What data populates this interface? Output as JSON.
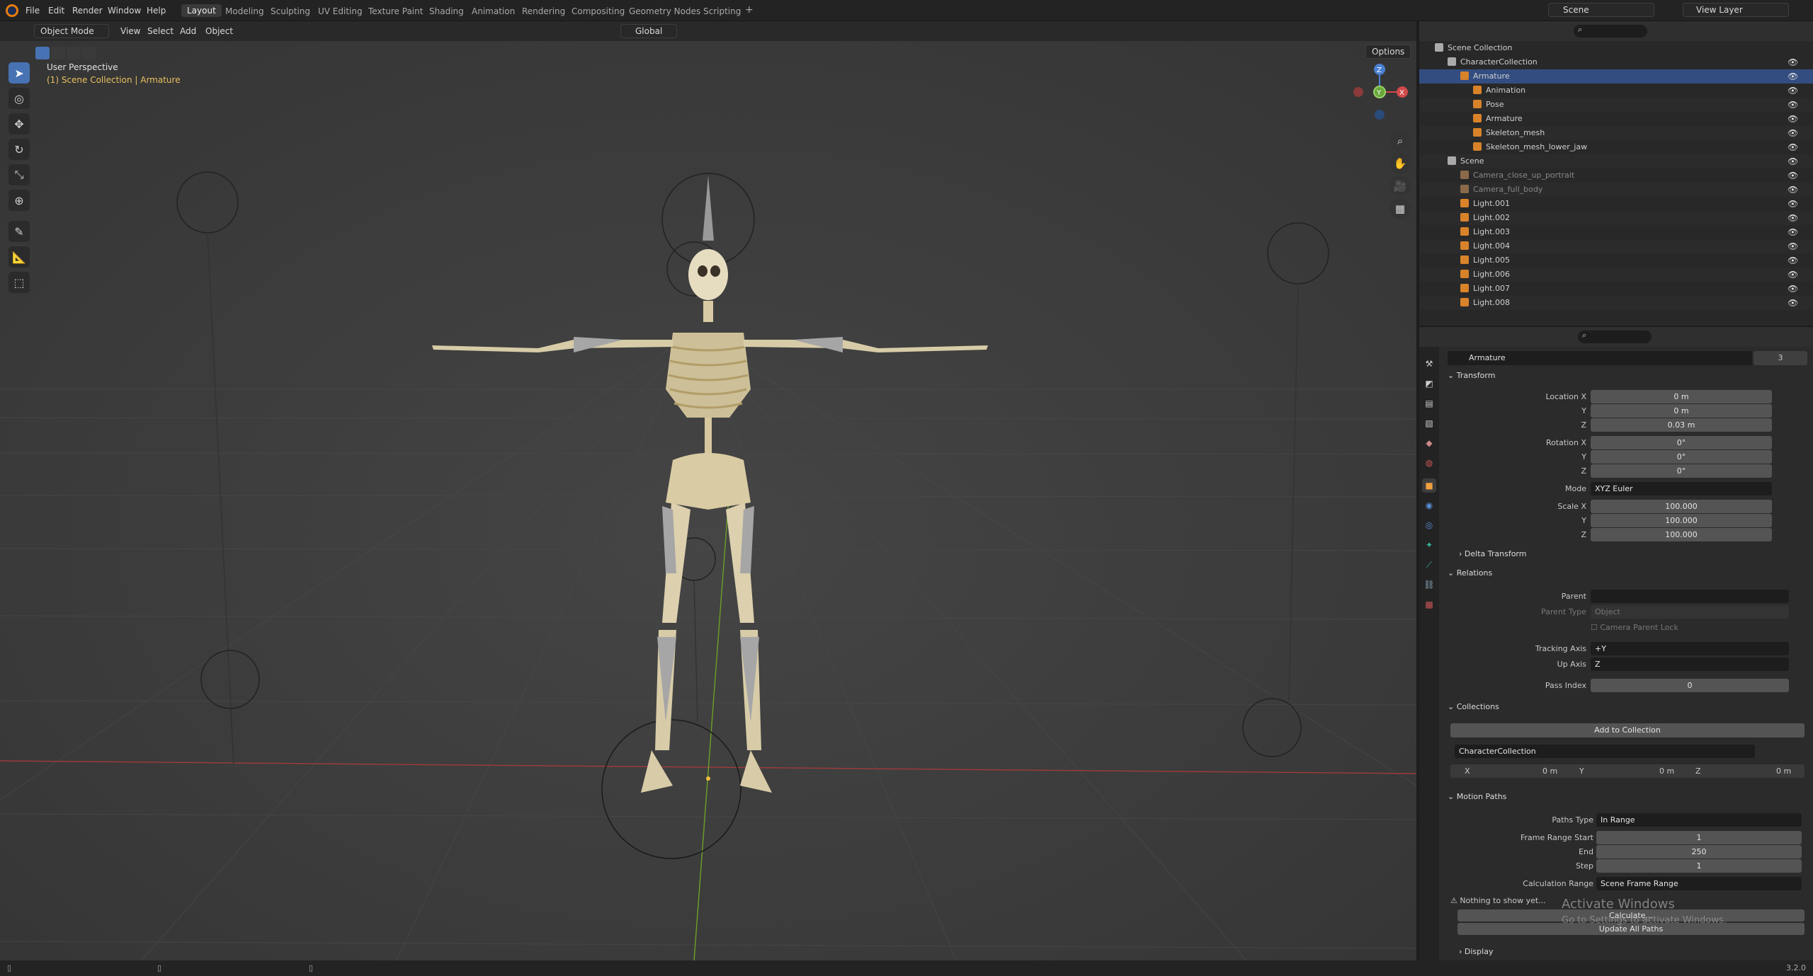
{
  "topbar": {
    "menus": [
      "File",
      "Edit",
      "Render",
      "Window",
      "Help"
    ],
    "workspaces": [
      "Layout",
      "Modeling",
      "Sculpting",
      "UV Editing",
      "Texture Paint",
      "Shading",
      "Animation",
      "Rendering",
      "Compositing",
      "Geometry Nodes",
      "Scripting"
    ],
    "active_workspace": "Layout",
    "add_tab": "+",
    "scene": "Scene",
    "view_layer": "View Layer"
  },
  "viewport": {
    "mode": "Object Mode",
    "menus": [
      "View",
      "Select",
      "Add",
      "Object"
    ],
    "orientation": "Global",
    "options": "Options",
    "perspective": "User Perspective",
    "context": "(1) Scene Collection | Armature",
    "gizmo": {
      "x": "X",
      "y": "Y",
      "z": "Z"
    }
  },
  "outliner": {
    "root": "Scene Collection",
    "rows": [
      {
        "label": "CharacterCollection",
        "level": 1
      },
      {
        "label": "Armature",
        "level": 2
      },
      {
        "label": "Animation",
        "level": 3
      },
      {
        "label": "Pose",
        "level": 3
      },
      {
        "label": "Armature",
        "level": 3
      },
      {
        "label": "Skeleton_mesh",
        "level": 3
      },
      {
        "label": "Skeleton_mesh_lower_jaw",
        "level": 3
      },
      {
        "label": "Scene",
        "level": 1
      },
      {
        "label": "Camera_close_up_portrait",
        "level": 2
      },
      {
        "label": "Camera_full_body",
        "level": 2
      },
      {
        "label": "Light.001",
        "level": 2
      },
      {
        "label": "Light.002",
        "level": 2
      },
      {
        "label": "Light.003",
        "level": 2
      },
      {
        "label": "Light.004",
        "level": 2
      },
      {
        "label": "Light.005",
        "level": 2
      },
      {
        "label": "Light.006",
        "level": 2
      },
      {
        "label": "Light.007",
        "level": 2
      },
      {
        "label": "Light.008",
        "level": 2
      }
    ]
  },
  "properties": {
    "object_name": "Armature",
    "users": "3",
    "transform": {
      "title": "Transform",
      "location_label": "Location X",
      "loc": [
        "0 m",
        "0 m",
        "0.03 m"
      ],
      "rotation_label": "Rotation X",
      "rot": [
        "0°",
        "0°",
        "0°"
      ],
      "mode_label": "Mode",
      "mode": "XYZ Euler",
      "scale_label": "Scale X",
      "scale": [
        "100.000",
        "100.000",
        "100.000"
      ],
      "y": "Y",
      "z": "Z"
    },
    "delta": "Delta Transform",
    "relations": {
      "title": "Relations",
      "parent_label": "Parent",
      "parent_type_label": "Parent Type",
      "parent_type": "Object",
      "camera_parent_lock": "Camera Parent Lock",
      "tracking_label": "Tracking Axis",
      "tracking": "+Y",
      "up_label": "Up Axis",
      "up": "Z",
      "pass_label": "Pass Index",
      "pass": "0"
    },
    "collections": {
      "title": "Collections",
      "add": "Add to Collection",
      "name": "CharacterCollection",
      "x_label": "X",
      "x": "0 m",
      "y_label": "Y",
      "y": "0 m",
      "z_label": "Z",
      "z": "0 m"
    },
    "motion_paths": {
      "title": "Motion Paths",
      "paths_type_label": "Paths Type",
      "paths_type": "In Range",
      "start_label": "Frame Range Start",
      "start": "1",
      "end_label": "End",
      "end": "250",
      "step_label": "Step",
      "step": "1",
      "calc_label": "Calculation Range",
      "calc": "Scene Frame Range",
      "nothing": "Nothing to show yet...",
      "calculate": "Calculate...",
      "update": "Update All Paths"
    },
    "display": "Display"
  },
  "watermark": {
    "title": "Activate Windows",
    "sub": "Go to Settings to activate Windows."
  },
  "statusbar": {
    "version": "3.2.0"
  }
}
